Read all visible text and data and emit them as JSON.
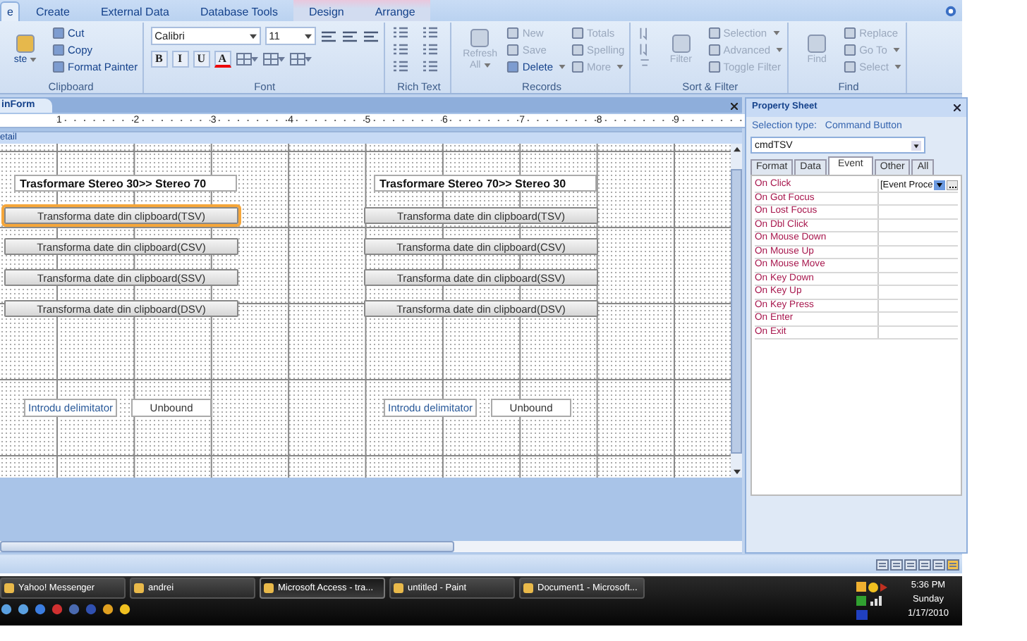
{
  "ribbon_tabs": [
    {
      "label": "e",
      "selected": true,
      "contextual": false
    },
    {
      "label": "Create",
      "selected": false,
      "contextual": false
    },
    {
      "label": "External Data",
      "selected": false,
      "contextual": false
    },
    {
      "label": "Database Tools",
      "selected": false,
      "contextual": false
    },
    {
      "label": "Design",
      "selected": false,
      "contextual": true
    },
    {
      "label": "Arrange",
      "selected": false,
      "contextual": true
    }
  ],
  "ribbon_groups": [
    {
      "label": "Clipboard",
      "items": [
        {
          "kind": "large",
          "label": "ste",
          "disabled": false,
          "dropdown": true
        },
        {
          "kind": "small",
          "label": "Cut",
          "disabled": false,
          "dropdown": false
        },
        {
          "kind": "small",
          "label": "Copy",
          "disabled": false,
          "dropdown": false
        },
        {
          "kind": "small",
          "label": "Format Painter",
          "disabled": false,
          "dropdown": false
        }
      ]
    },
    {
      "label": "Font",
      "items": [
        {
          "kind": "combo",
          "label": "Calibri"
        },
        {
          "kind": "combo",
          "label": "11"
        },
        {
          "kind": "align"
        },
        {
          "kind": "align"
        },
        {
          "kind": "align"
        },
        {
          "kind": "format",
          "label": "B"
        },
        {
          "kind": "format",
          "label": "I"
        },
        {
          "kind": "format",
          "label": "U"
        },
        {
          "kind": "format",
          "label": "A"
        },
        {
          "kind": "tool"
        },
        {
          "kind": "tool"
        },
        {
          "kind": "tool"
        }
      ]
    },
    {
      "label": "Rich Text",
      "items": [
        {
          "kind": "tool"
        },
        {
          "kind": "tool"
        },
        {
          "kind": "tool"
        },
        {
          "kind": "tool"
        },
        {
          "kind": "tool"
        },
        {
          "kind": "tool"
        }
      ]
    },
    {
      "label": "Records",
      "items": [
        {
          "kind": "large",
          "label": "Refresh All",
          "disabled": true,
          "dropdown": true
        },
        {
          "kind": "small",
          "label": "New",
          "disabled": true,
          "dropdown": false
        },
        {
          "kind": "small",
          "label": "Save",
          "disabled": true,
          "dropdown": false
        },
        {
          "kind": "small",
          "label": "Delete",
          "disabled": false,
          "dropdown": true
        },
        {
          "kind": "small",
          "label": "Totals",
          "disabled": true,
          "dropdown": false
        },
        {
          "kind": "small",
          "label": "Spelling",
          "disabled": true,
          "dropdown": false
        },
        {
          "kind": "small",
          "label": "More",
          "disabled": true,
          "dropdown": true
        }
      ]
    },
    {
      "label": "Sort & Filter",
      "items": [
        {
          "kind": "sort"
        },
        {
          "kind": "large",
          "label": "Filter",
          "disabled": true,
          "dropdown": false
        },
        {
          "kind": "small",
          "label": "Selection",
          "disabled": true,
          "dropdown": true
        },
        {
          "kind": "small",
          "label": "Advanced",
          "disabled": true,
          "dropdown": true
        },
        {
          "kind": "small",
          "label": "Toggle Filter",
          "disabled": true,
          "dropdown": false
        }
      ]
    },
    {
      "label": "Find",
      "items": [
        {
          "kind": "large",
          "label": "Find",
          "disabled": true,
          "dropdown": false
        },
        {
          "kind": "small",
          "label": "Replace",
          "disabled": true,
          "dropdown": false
        },
        {
          "kind": "small",
          "label": "Go To",
          "disabled": true,
          "dropdown": true
        },
        {
          "kind": "small",
          "label": "Select",
          "disabled": true,
          "dropdown": true
        }
      ]
    }
  ],
  "document": {
    "tab": "inForm",
    "ruler": [
      "1",
      "2",
      "3",
      "4",
      "5",
      "6",
      "7",
      "8",
      "9"
    ],
    "section": "etail",
    "columns": [
      {
        "title": "Trasformare Stereo 30>> Stereo 70",
        "buttons": [
          {
            "label": "Transforma date din clipboard(TSV)",
            "selected": true
          },
          {
            "label": "Transforma date din clipboard(CSV)",
            "selected": false
          },
          {
            "label": "Transforma date din clipboard(SSV)",
            "selected": false
          },
          {
            "label": "Transforma date din clipboard(DSV)",
            "selected": false
          }
        ],
        "delimiter_label": "Introdu delimitator",
        "unbound": "Unbound"
      },
      {
        "title": "Trasformare Stereo 70>> Stereo 30",
        "buttons": [
          {
            "label": "Transforma date din clipboard(TSV)",
            "selected": false
          },
          {
            "label": "Transforma date din clipboard(CSV)",
            "selected": false
          },
          {
            "label": "Transforma date din clipboard(SSV)",
            "selected": false
          },
          {
            "label": "Transforma date din clipboard(DSV)",
            "selected": false
          }
        ],
        "delimiter_label": "Introdu delimitator",
        "unbound": "Unbound"
      }
    ]
  },
  "property_sheet": {
    "title": "Property Sheet",
    "selection_label": "Selection type:",
    "selection_type": "Command Button",
    "object": "cmdTSV",
    "tabs": [
      {
        "label": "Format",
        "selected": false
      },
      {
        "label": "Data",
        "selected": false
      },
      {
        "label": "Event",
        "selected": true
      },
      {
        "label": "Other",
        "selected": false
      },
      {
        "label": "All",
        "selected": false
      }
    ],
    "rows": [
      {
        "name": "On Click",
        "value": "[Event Proce"
      },
      {
        "name": "On Got Focus"
      },
      {
        "name": "On Lost Focus"
      },
      {
        "name": "On Dbl Click"
      },
      {
        "name": "On Mouse Down"
      },
      {
        "name": "On Mouse Up"
      },
      {
        "name": "On Mouse Move"
      },
      {
        "name": "On Key Down"
      },
      {
        "name": "On Key Up"
      },
      {
        "name": "On Key Press"
      },
      {
        "name": "On Enter"
      },
      {
        "name": "On Exit"
      }
    ]
  },
  "taskbar": {
    "tasks": [
      {
        "label": "Yahoo! Messenger",
        "selected": false
      },
      {
        "label": "andrei",
        "selected": false
      },
      {
        "label": "Microsoft Access - tra...",
        "selected": true
      },
      {
        "label": "untitled - Paint",
        "selected": false
      },
      {
        "label": "Document1 - Microsoft...",
        "selected": false
      }
    ],
    "clock": {
      "time": "5:36 PM",
      "day": "Sunday",
      "date": "1/17/2010"
    }
  }
}
